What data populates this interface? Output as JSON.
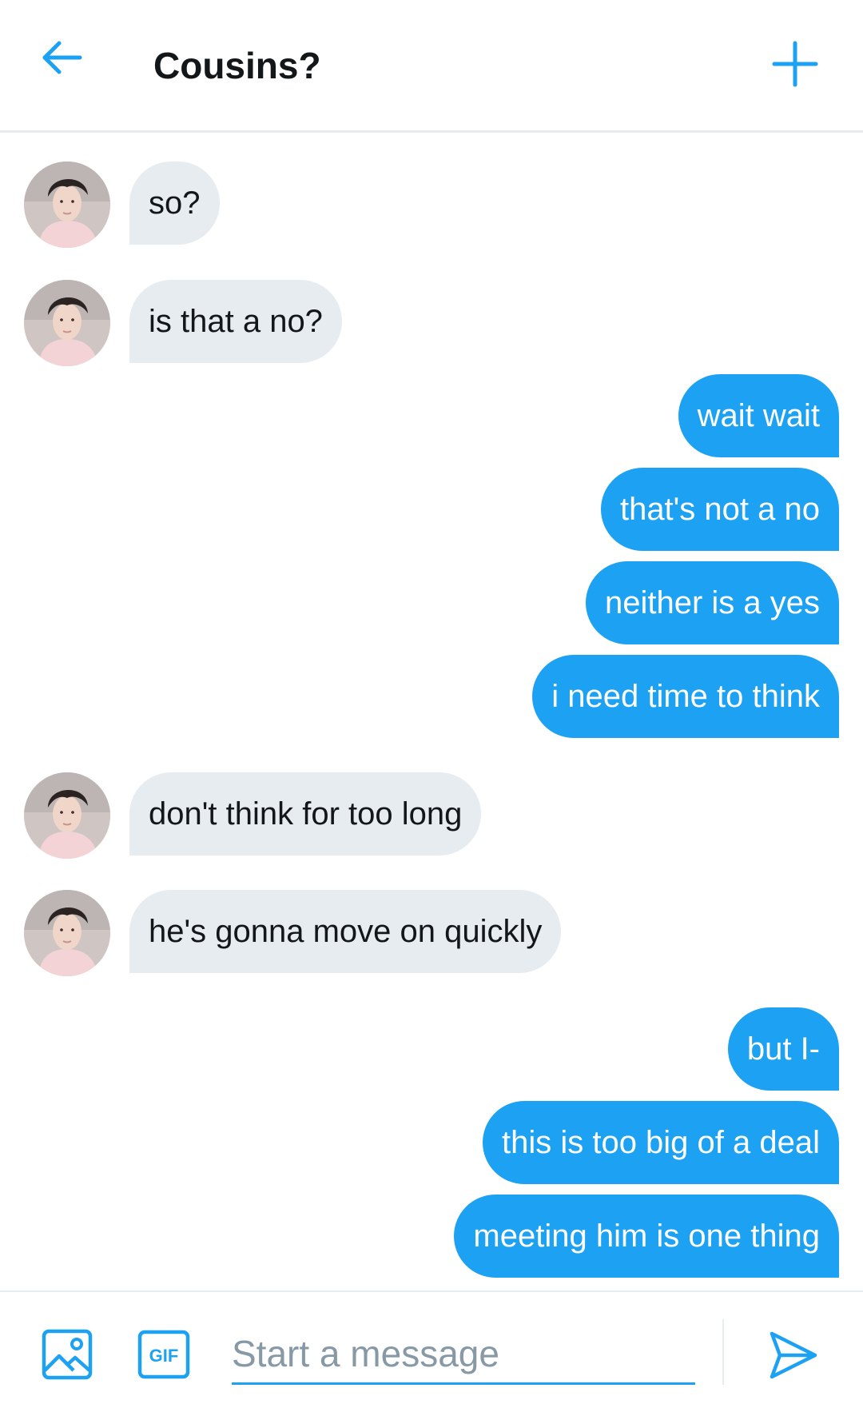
{
  "header": {
    "title": "Cousins?",
    "back_icon": "arrow-left-icon",
    "add_icon": "plus-icon"
  },
  "colors": {
    "accent": "#1da1f2",
    "incoming_bubble": "#e6ecf0",
    "text": "#14171a",
    "placeholder": "#8899a6"
  },
  "messages": [
    {
      "side": "in",
      "text": "so?"
    },
    {
      "side": "in",
      "text": "is that a no?"
    },
    {
      "side": "out",
      "text": "wait wait"
    },
    {
      "side": "out",
      "text": "that's not a no"
    },
    {
      "side": "out",
      "text": "neither is a yes"
    },
    {
      "side": "out",
      "text": "i need time to think"
    },
    {
      "side": "in",
      "text": "don't think for too long"
    },
    {
      "side": "in",
      "text": "he's gonna move on quickly"
    },
    {
      "side": "out",
      "text": "but I-"
    },
    {
      "side": "out",
      "text": "this is too big of a deal"
    },
    {
      "side": "out",
      "text": "meeting him is one thing"
    }
  ],
  "composer": {
    "placeholder": "Start a message",
    "media_icon": "image-icon",
    "gif_icon": "gif-icon",
    "gif_label": "GIF",
    "send_icon": "send-icon"
  }
}
